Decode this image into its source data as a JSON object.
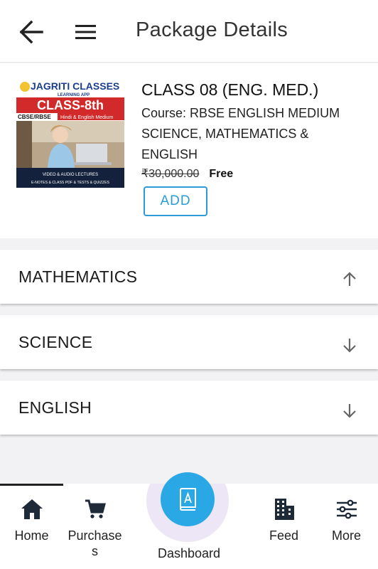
{
  "header": {
    "title": "Package Details"
  },
  "package": {
    "name": "CLASS 08 (ENG. MED.)",
    "course": "Course: RBSE ENGLISH MEDIUM SCIENCE, MATHEMATICS & ENGLISH",
    "old_price": "₹30,000.00",
    "price": "Free",
    "add_label": "ADD",
    "thumbnail": {
      "brand": "JAGRITI CLASSES",
      "brand_sub": "LEARNING APP",
      "class_text": "CLASS-8th",
      "board": "CBSE/RBSE",
      "medium": "Hindi & English Medium",
      "line1": "VIDEO & AUDIO LECTURES",
      "line2": "E-NOTES & CLASS PDF & TESTS & QUIZZES"
    }
  },
  "subjects": [
    {
      "label": "MATHEMATICS",
      "expanded": true
    },
    {
      "label": "SCIENCE",
      "expanded": false
    },
    {
      "label": "ENGLISH",
      "expanded": false
    }
  ],
  "bottom_nav": {
    "home": "Home",
    "purchases": "Purchase s",
    "dashboard": "Dashboard",
    "feed": "Feed",
    "more": "More"
  },
  "colors": {
    "accent": "#2aa8e6",
    "add_border": "#2b9bd8",
    "background": "#f2f2f4"
  }
}
